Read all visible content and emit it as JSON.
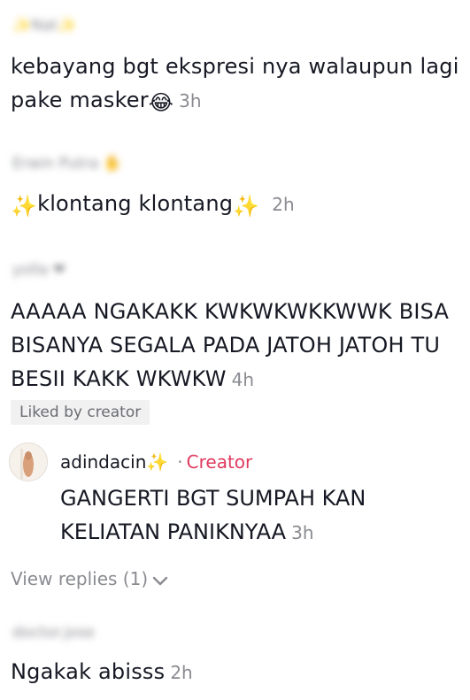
{
  "comments": [
    {
      "username": "Nat",
      "text": "kebayang bgt ekspresi nya walaupun lagi pake masker",
      "emoji_after": "😂",
      "time": "3h"
    },
    {
      "username": "Erwin Putra",
      "text": "klontang klontang",
      "emoji_before": "✨",
      "emoji_after": "✨",
      "time": "2h"
    },
    {
      "username": "yolla",
      "text": "AAAAA NGAKAKK KWKWKWKKWWK BISA BISANYA SEGALA PADA JATOH JATOH TU BESII KAKK WKWKW",
      "time": "4h",
      "liked_badge": "Liked by creator",
      "reply": {
        "username": "adindacin",
        "sparkle": "✨",
        "separator": "·",
        "creator_label": "Creator",
        "text": "GANGERTI BGT SUMPAH KAN KELIATAN PANIKNYAA",
        "time": "3h"
      },
      "view_replies": "View replies (1)"
    },
    {
      "username": "doctor.jose",
      "text": "Ngakak abisss",
      "time": "2h"
    }
  ],
  "colors": {
    "text": "#161823",
    "secondary": "#8a8b91",
    "creator": "#e03a5e",
    "badge_bg": "#f1f1f2"
  },
  "icons": {
    "sparkle": "sparkle-icon",
    "chevron": "chevron-down-icon"
  }
}
